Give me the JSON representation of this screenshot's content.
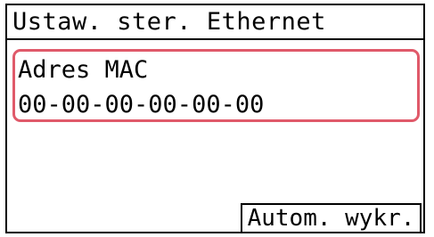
{
  "header": {
    "title": "Ustaw. ster. Ethernet"
  },
  "item": {
    "label": "Adres MAC",
    "value": "00-00-00-00-00-00"
  },
  "softkey": {
    "label": "Autom. wykr."
  },
  "colors": {
    "highlight_border": "#e05a6a",
    "text": "#000000",
    "background": "#ffffff"
  }
}
